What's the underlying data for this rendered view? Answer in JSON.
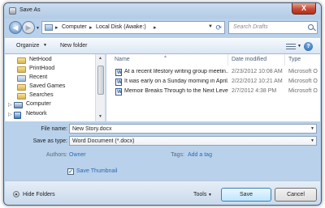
{
  "window": {
    "title": "Save As",
    "close_label": "X"
  },
  "nav": {
    "back_glyph": "◀",
    "forward_glyph": "▶",
    "recent_glyph": "▼"
  },
  "address": {
    "segments": [
      "Computer",
      "Local Disk (Awake:)"
    ],
    "separator": "▸",
    "dropdown_glyph": "▼",
    "refresh_glyph": "⟳"
  },
  "search": {
    "placeholder": "Search Drafts"
  },
  "toolbar": {
    "organize_label": "Organize",
    "dropdown_glyph": "▼",
    "new_folder_label": "New folder",
    "help_glyph": "?"
  },
  "navpane": {
    "items": [
      {
        "label": "NetHood",
        "icon": "folder"
      },
      {
        "label": "PrintHood",
        "icon": "folder"
      },
      {
        "label": "Recent",
        "icon": "recent"
      },
      {
        "label": "Saved Games",
        "icon": "folder"
      },
      {
        "label": "Searches",
        "icon": "folder"
      },
      {
        "label": "Computer",
        "icon": "computer"
      },
      {
        "label": "Network",
        "icon": "network"
      }
    ],
    "expand_glyph": "▷",
    "scroll_up": "▲",
    "scroll_down": "▼"
  },
  "filelist": {
    "columns": {
      "name": "Name",
      "date": "Date modified",
      "type": "Type"
    },
    "sort_glyph": "▲",
    "rows": [
      {
        "name": "At a recent lifestory writing group meetin...",
        "date": "2/23/2012 10:08 AM",
        "type": "Microsoft O"
      },
      {
        "name": "It was early on a Sunday morning in April...",
        "date": "2/22/2012 10:21 AM",
        "type": "Microsoft O"
      },
      {
        "name": "Memoir Breaks Through to the Next Leve...",
        "date": "2/7/2012 4:38 PM",
        "type": "Microsoft O"
      }
    ]
  },
  "form": {
    "filename_label": "File name:",
    "filename_value": "New Story.docx",
    "savetype_label": "Save as type:",
    "savetype_value": "Word Document (*.docx)",
    "authors_label": "Authors:",
    "authors_value": "Owner",
    "tags_label": "Tags:",
    "tags_value": "Add a tag",
    "thumbnail_label": "Save Thumbnail",
    "thumbnail_checked": true,
    "check_glyph": "✓",
    "dropdown_glyph": "▼"
  },
  "footer": {
    "hide_folders_label": "Hide Folders",
    "hide_folders_glyph": "▲",
    "tools_label": "Tools",
    "save_label": "Save",
    "cancel_label": "Cancel",
    "dropdown_glyph": "▼"
  }
}
